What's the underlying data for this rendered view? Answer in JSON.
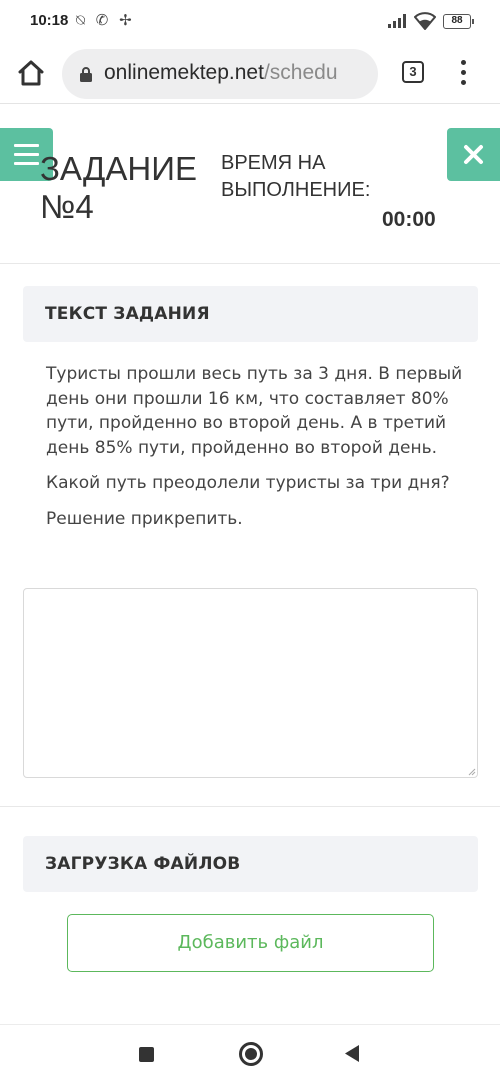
{
  "status_bar": {
    "time": "10:18",
    "left_icons": "⍉ ✆ ✢",
    "battery": "88"
  },
  "browser": {
    "url_host": "onlinemektep.net",
    "url_path": "/schedu",
    "tab_count": "3"
  },
  "header": {
    "title_line1": "ЗАДАНИЕ",
    "title_line2": "№4",
    "time_label_line1": "ВРЕМЯ НА",
    "time_label_line2": "ВЫПОЛНЕНИЕ:",
    "time_value": "00:00"
  },
  "task": {
    "heading": "ТЕКСТ ЗАДАНИЯ",
    "paragraphs": [
      "Туристы прошли весь путь за 3 дня. В первый день они прошли 16 км, что составляет 80% пути, пройденно во второй день. А в третий день 85% пути, пройденно во второй день.",
      "Какой путь преодолели туристы за три дня?",
      "Решение прикрепить."
    ],
    "answer_value": ""
  },
  "upload": {
    "heading": "ЗАГРУЗКА ФАЙЛОВ",
    "add_file_label": "Добавить файл"
  },
  "colors": {
    "accent": "#5cc0a0",
    "button_green": "#5cb85c",
    "panel_bg": "#f2f3f6"
  }
}
